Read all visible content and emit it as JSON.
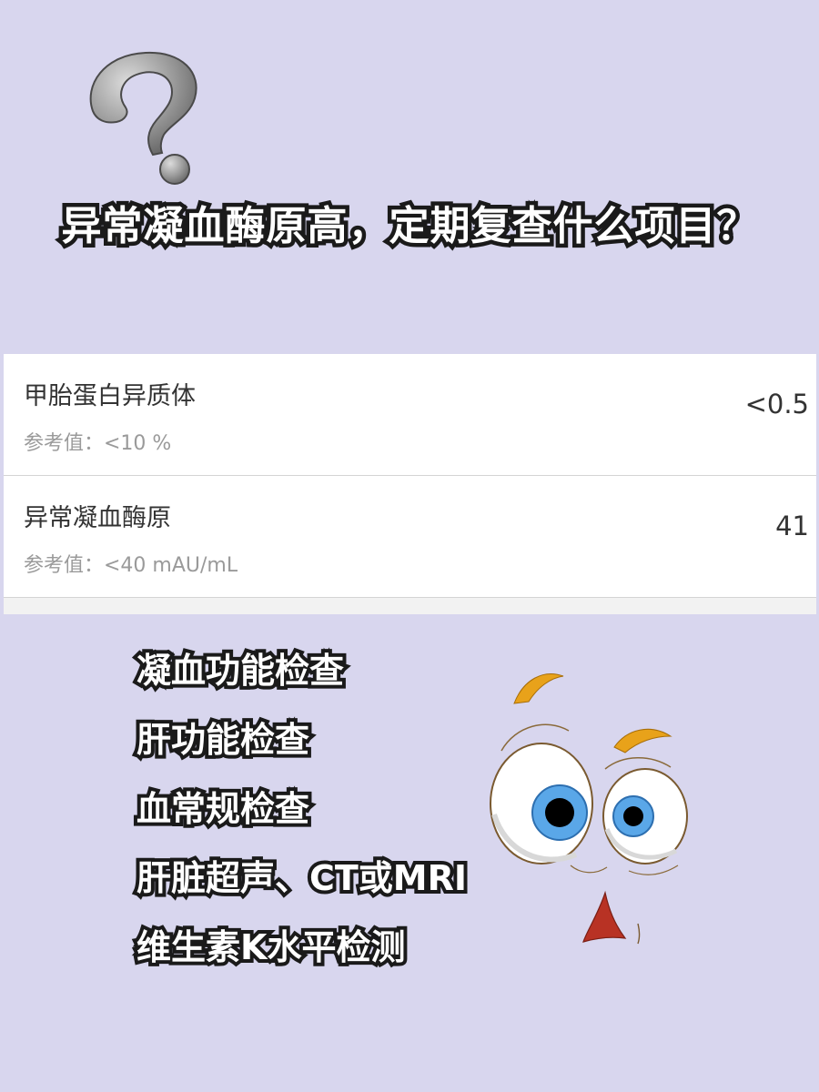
{
  "title": "异常凝血酶原高，定期复查什么项目？",
  "results": [
    {
      "name": "甲胎蛋白异质体",
      "reference": "参考值：<10 %",
      "value": "<0.5"
    },
    {
      "name": "异常凝血酶原",
      "reference": "参考值：<40 mAU/mL",
      "value": "41"
    }
  ],
  "checklist": [
    "凝血功能检查",
    "肝功能检查",
    "血常规检查",
    "肝脏超声、CT或MRI",
    "维生素K水平检测"
  ],
  "icons": [
    "question-mark-icon",
    "confused-face-icon"
  ],
  "colors": {
    "background": "#d8d6ee",
    "card": "#ffffff",
    "title_fill": "#ffffff",
    "title_outline": "#1a1a1a",
    "eyebrow": "#e8a21a",
    "iris": "#5aa7e8",
    "mouth": "#b83224"
  }
}
